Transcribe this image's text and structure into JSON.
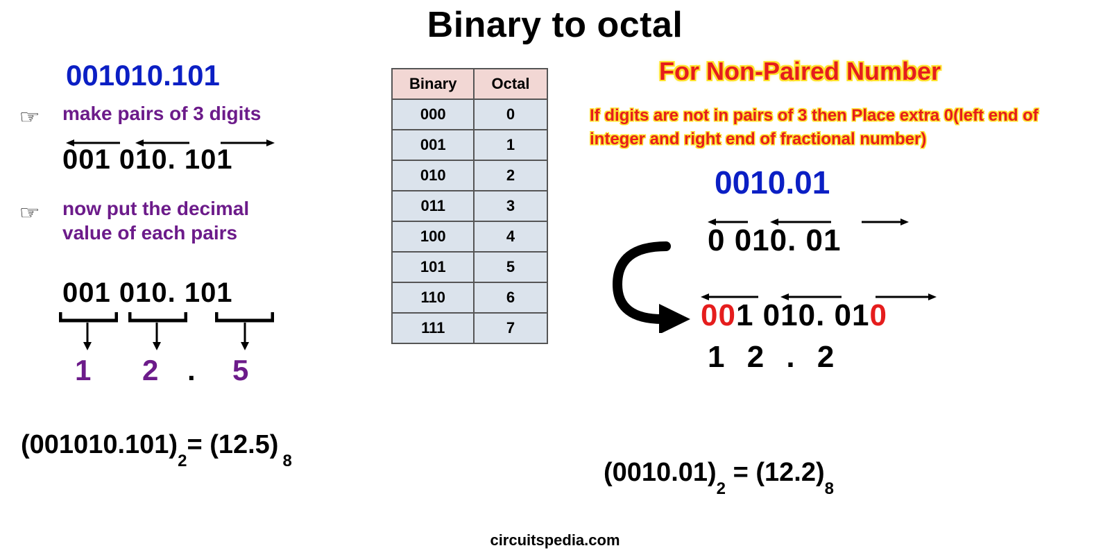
{
  "title": "Binary to octal",
  "footer": "circuitspedia.com",
  "left": {
    "binary": "001010.101",
    "step1": "make pairs of 3 digits",
    "grouped": "001 010. 101",
    "step2a": "now put the decimal",
    "step2b": "value of each pairs",
    "grouped2": "001 010. 101",
    "octal_results": {
      "a": "1",
      "b": "2",
      "dot": ".",
      "c": "5"
    },
    "equation_binary": "(001010.101)",
    "equation_octal": "(12.5)",
    "sub2": "2",
    "sub8": "8"
  },
  "table": {
    "h1": "Binary",
    "h2": "Octal",
    "rows": [
      [
        "000",
        "0"
      ],
      [
        "001",
        "1"
      ],
      [
        "010",
        "2"
      ],
      [
        "011",
        "3"
      ],
      [
        "100",
        "4"
      ],
      [
        "101",
        "5"
      ],
      [
        "110",
        "6"
      ],
      [
        "111",
        "7"
      ]
    ]
  },
  "right": {
    "heading": "For Non-Paired Number",
    "note": "If digits are not in pairs of 3 then Place extra 0(left end of integer and right end of fractional number)",
    "binary": "0010.01",
    "grouped": "0  010. 01",
    "padded_parts": [
      {
        "t": "0",
        "c": "red"
      },
      {
        "t": "0",
        "c": "red"
      },
      {
        "t": "1 ",
        "c": "blk"
      },
      {
        "t": "010. ",
        "c": "blk"
      },
      {
        "t": "01",
        "c": "blk"
      },
      {
        "t": "0",
        "c": "red"
      }
    ],
    "result": "1   2 .  2",
    "equation_binary": "(0010.01)",
    "equation_octal": "(12.2)",
    "sub2": "2",
    "sub8": "8"
  }
}
